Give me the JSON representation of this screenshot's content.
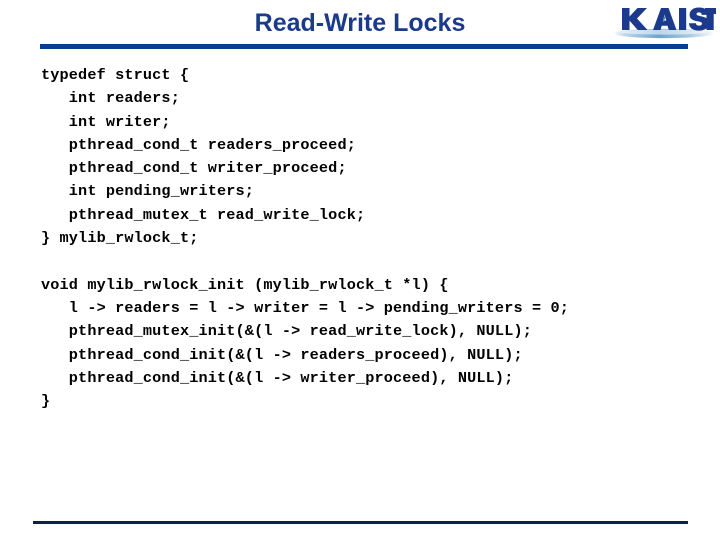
{
  "slide": {
    "title": "Read-Write Locks",
    "title_color": "#1b3a8c",
    "background_color": "#ffffff"
  },
  "logo": {
    "name": "kaist-logo",
    "wordmark_text": "KAIST",
    "wordmark_color": "#1b3a8c",
    "swoosh_color": "#a8c8e4"
  },
  "rules": {
    "header_rule_color": "#0a3d91",
    "footer_rule_color": "#0d2240"
  },
  "code": {
    "language": "c",
    "lines": [
      "typedef struct {",
      "   int readers;",
      "   int writer;",
      "   pthread_cond_t readers_proceed;",
      "   pthread_cond_t writer_proceed;",
      "   int pending_writers;",
      "   pthread_mutex_t read_write_lock;",
      "} mylib_rwlock_t;",
      "",
      "void mylib_rwlock_init (mylib_rwlock_t *l) {",
      "   l -> readers = l -> writer = l -> pending_writers = 0;",
      "   pthread_mutex_init(&(l -> read_write_lock), NULL);",
      "   pthread_cond_init(&(l -> readers_proceed), NULL);",
      "   pthread_cond_init(&(l -> writer_proceed), NULL);",
      "}"
    ]
  }
}
